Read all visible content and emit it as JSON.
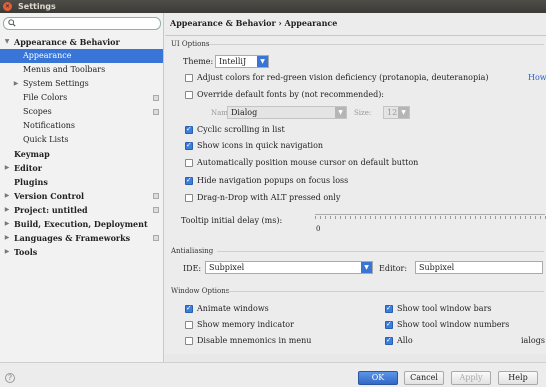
{
  "window": {
    "title": "Settings"
  },
  "search": {
    "placeholder": ""
  },
  "sidebar": {
    "items": [
      {
        "label": "Appearance & Behavior",
        "arrow": "▼",
        "bold": true,
        "level": 0,
        "config": false
      },
      {
        "label": "Appearance",
        "arrow": "",
        "bold": false,
        "level": 1,
        "selected": true,
        "config": false
      },
      {
        "label": "Menus and Toolbars",
        "arrow": "",
        "bold": false,
        "level": 1,
        "config": false
      },
      {
        "label": "System Settings",
        "arrow": "▶",
        "bold": false,
        "level": 1,
        "config": false
      },
      {
        "label": "File Colors",
        "arrow": "",
        "bold": false,
        "level": 1,
        "config": true
      },
      {
        "label": "Scopes",
        "arrow": "",
        "bold": false,
        "level": 1,
        "config": true
      },
      {
        "label": "Notifications",
        "arrow": "",
        "bold": false,
        "level": 1,
        "config": false
      },
      {
        "label": "Quick Lists",
        "arrow": "",
        "bold": false,
        "level": 1,
        "config": false
      },
      {
        "label": "Keymap",
        "arrow": "",
        "bold": true,
        "level": 0,
        "config": false
      },
      {
        "label": "Editor",
        "arrow": "▶",
        "bold": true,
        "level": 0,
        "config": false
      },
      {
        "label": "Plugins",
        "arrow": "",
        "bold": true,
        "level": 0,
        "config": false
      },
      {
        "label": "Version Control",
        "arrow": "▶",
        "bold": true,
        "level": 0,
        "config": true
      },
      {
        "label": "Project: untitled",
        "arrow": "▶",
        "bold": true,
        "level": 0,
        "config": true
      },
      {
        "label": "Build, Execution, Deployment",
        "arrow": "▶",
        "bold": true,
        "level": 0,
        "config": false
      },
      {
        "label": "Languages & Frameworks",
        "arrow": "▶",
        "bold": true,
        "level": 0,
        "config": true
      },
      {
        "label": "Tools",
        "arrow": "▶",
        "bold": true,
        "level": 0,
        "config": false
      }
    ]
  },
  "breadcrumb": "Appearance & Behavior › Appearance",
  "ui_options": {
    "section_label": "UI Options",
    "theme_label": "Theme:",
    "theme_value": "IntelliJ",
    "adjust_colors": {
      "label": "Adjust colors for red-green vision deficiency (protanopia, deuteranopia)",
      "link": "How",
      "checked": false
    },
    "override_fonts": {
      "label": "Override default fonts by (not recommended):",
      "checked": false
    },
    "font_name_label": "Name:",
    "font_name_value": "Dialog",
    "font_size_label": "Size:",
    "font_size_value": "12",
    "cyclic_scrolling": {
      "label": "Cyclic scrolling in list",
      "checked": true
    },
    "show_icons": {
      "label": "Show icons in quick navigation",
      "checked": true
    },
    "auto_position": {
      "label": "Automatically position mouse cursor on default button",
      "checked": false
    },
    "hide_nav_popups": {
      "label": "Hide navigation popups on focus loss",
      "checked": true
    },
    "drag_drop_alt": {
      "label": "Drag-n-Drop with ALT pressed only",
      "checked": false
    },
    "tooltip_label": "Tooltip initial delay (ms):",
    "tooltip_min": "0"
  },
  "antialiasing": {
    "section_label": "Antialiasing",
    "ide_label": "IDE:",
    "ide_value": "Subpixel",
    "editor_label": "Editor:",
    "editor_value": "Subpixel"
  },
  "window_options": {
    "section_label": "Window Options",
    "left": [
      {
        "label": "Animate windows",
        "checked": true
      },
      {
        "label": "Show memory indicator",
        "checked": false
      },
      {
        "label": "Disable mnemonics in menu",
        "checked": false
      }
    ],
    "right": [
      {
        "label": "Show tool window bars",
        "checked": true
      },
      {
        "label": "Show tool window numbers",
        "checked": true
      },
      {
        "label": "Allo",
        "checked": true
      },
      {
        "label": "ialogs",
        "checked": false
      }
    ]
  },
  "footer": {
    "ok": "OK",
    "cancel": "Cancel",
    "apply": "Apply",
    "help": "Help",
    "question": "?"
  },
  "colors": {
    "accent": "#3875d7",
    "selection_text": "#ffffff"
  }
}
